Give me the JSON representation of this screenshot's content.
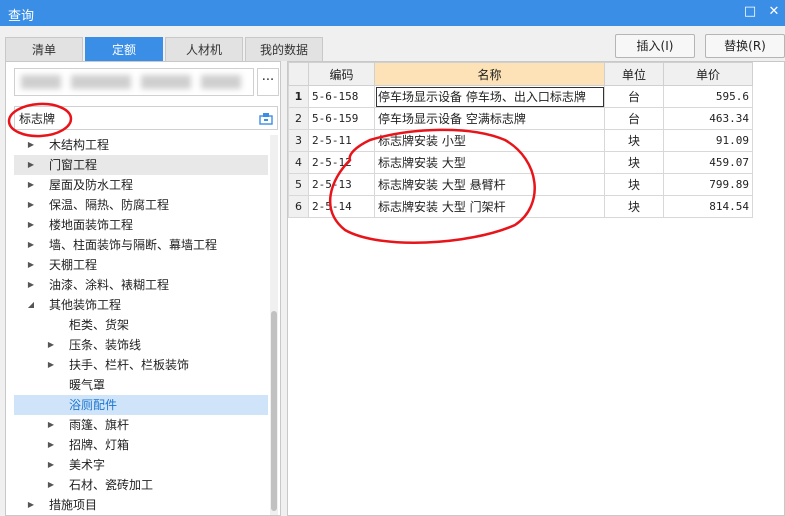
{
  "window": {
    "title": "查询",
    "maximize_glyph": "□",
    "close_glyph": "✕"
  },
  "tabs": [
    {
      "label": "清单",
      "active": false
    },
    {
      "label": "定额",
      "active": true
    },
    {
      "label": "人材机",
      "active": false
    },
    {
      "label": "我的数据",
      "active": false
    }
  ],
  "actions": {
    "insert_label": "插入(I)",
    "replace_label": "替换(R)"
  },
  "left": {
    "more_glyph": "···",
    "search": {
      "value": "标志牌",
      "placeholder": ""
    },
    "tree": [
      {
        "label": "木结构工程",
        "arrow": "▶",
        "level": 1,
        "state": ""
      },
      {
        "label": "门窗工程",
        "arrow": "▶",
        "level": 1,
        "state": "hl"
      },
      {
        "label": "屋面及防水工程",
        "arrow": "▶",
        "level": 1,
        "state": ""
      },
      {
        "label": "保温、隔热、防腐工程",
        "arrow": "▶",
        "level": 1,
        "state": ""
      },
      {
        "label": "楼地面装饰工程",
        "arrow": "▶",
        "level": 1,
        "state": ""
      },
      {
        "label": "墙、柱面装饰与隔断、幕墙工程",
        "arrow": "▶",
        "level": 1,
        "state": ""
      },
      {
        "label": "天棚工程",
        "arrow": "▶",
        "level": 1,
        "state": ""
      },
      {
        "label": "油漆、涂料、裱糊工程",
        "arrow": "▶",
        "level": 1,
        "state": ""
      },
      {
        "label": "其他装饰工程",
        "arrow": "◢",
        "level": 1,
        "state": ""
      },
      {
        "label": "柜类、货架",
        "arrow": "",
        "level": 2,
        "state": ""
      },
      {
        "label": "压条、装饰线",
        "arrow": "▶",
        "level": 2,
        "state": ""
      },
      {
        "label": "扶手、栏杆、栏板装饰",
        "arrow": "▶",
        "level": 2,
        "state": ""
      },
      {
        "label": "暖气罩",
        "arrow": "",
        "level": 2,
        "state": ""
      },
      {
        "label": "浴厕配件",
        "arrow": "",
        "level": 2,
        "state": "sel"
      },
      {
        "label": "雨篷、旗杆",
        "arrow": "▶",
        "level": 2,
        "state": ""
      },
      {
        "label": "招牌、灯箱",
        "arrow": "▶",
        "level": 2,
        "state": ""
      },
      {
        "label": "美术字",
        "arrow": "▶",
        "level": 2,
        "state": ""
      },
      {
        "label": "石材、瓷砖加工",
        "arrow": "▶",
        "level": 2,
        "state": ""
      },
      {
        "label": "措施项目",
        "arrow": "▶",
        "level": 1,
        "state": ""
      }
    ]
  },
  "grid": {
    "headers": {
      "code": "编码",
      "name": "名称",
      "unit": "单位",
      "price": "单价"
    },
    "rows": [
      {
        "n": "1",
        "code": "5-6-158",
        "name": "停车场显示设备 停车场、出入口标志牌",
        "unit": "台",
        "price": "595.6"
      },
      {
        "n": "2",
        "code": "5-6-159",
        "name": "停车场显示设备 空满标志牌",
        "unit": "台",
        "price": "463.34"
      },
      {
        "n": "3",
        "code": "2-5-11",
        "name": "标志牌安装 小型",
        "unit": "块",
        "price": "91.09"
      },
      {
        "n": "4",
        "code": "2-5-12",
        "name": "标志牌安装 大型",
        "unit": "块",
        "price": "459.07"
      },
      {
        "n": "5",
        "code": "2-5-13",
        "name": "标志牌安装 大型 悬臂杆",
        "unit": "块",
        "price": "799.89"
      },
      {
        "n": "6",
        "code": "2-5-14",
        "name": "标志牌安装 大型 门架杆",
        "unit": "块",
        "price": "814.54"
      }
    ]
  },
  "colors": {
    "titlebar": "#3a8ee6",
    "annotation": "#e8141a",
    "name_header": "#fce2b6",
    "selected_row": "#cfe4f8"
  }
}
